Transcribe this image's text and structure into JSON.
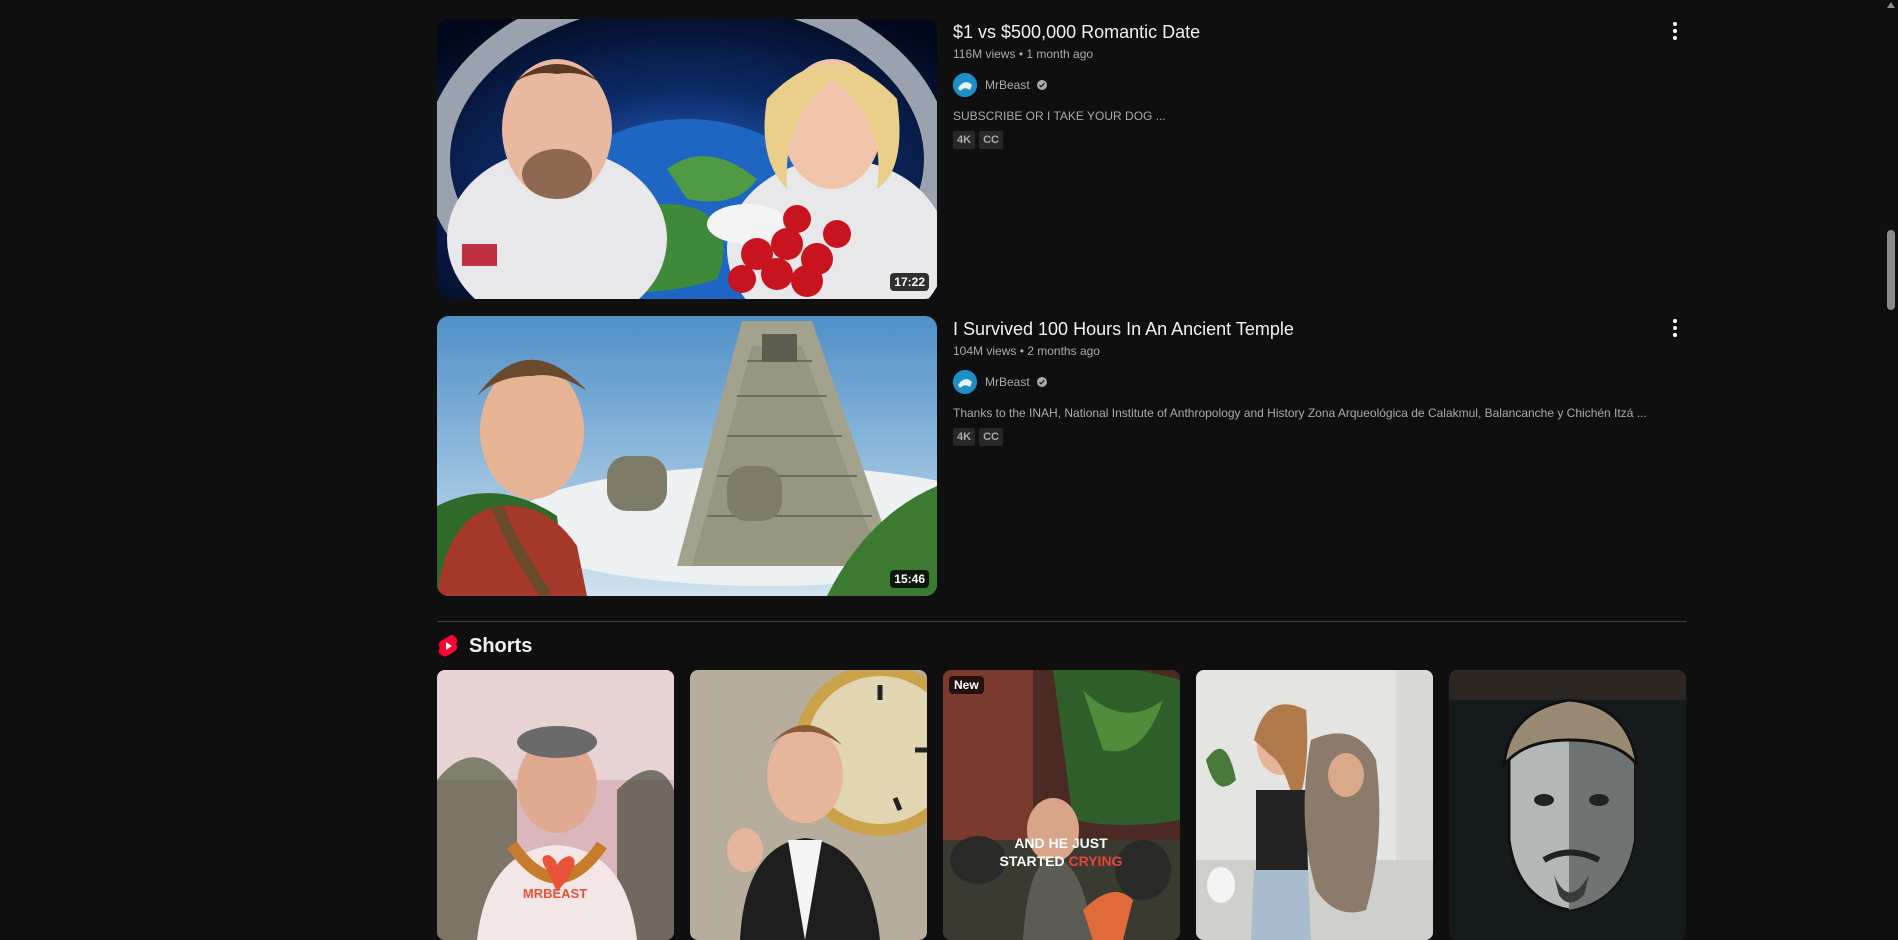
{
  "videos": [
    {
      "title": "$1 vs $500,000 Romantic Date",
      "views": "116M views",
      "age": "1 month ago",
      "channel": "MrBeast",
      "description": "SUBSCRIBE OR I TAKE YOUR DOG ...",
      "badges": [
        "4K",
        "CC"
      ],
      "duration": "17:22"
    },
    {
      "title": "I Survived 100 Hours In An Ancient Temple",
      "views": "104M views",
      "age": "2 months ago",
      "channel": "MrBeast",
      "description": "Thanks to the INAH, National Institute of Anthropology and History Zona Arqueológica de Calakmul, Balancanche y Chichén Itzá ...",
      "badges": [
        "4K",
        "CC"
      ],
      "duration": "15:46"
    }
  ],
  "meta_separator": "•",
  "shorts": {
    "title": "Shorts",
    "items": [
      {
        "overlay": "MRBEAST"
      },
      {
        "overlay": ""
      },
      {
        "badge": "New",
        "caption_line1": "AND HE JUST",
        "caption_line2_a": "STARTED ",
        "caption_line2_b": "CRYING"
      },
      {
        "overlay": ""
      },
      {
        "overlay": ""
      }
    ]
  },
  "colors": {
    "background": "#0f0f0f",
    "shorts_red": "#ff0033",
    "text_primary": "#f1f1f1",
    "text_secondary": "#aaaaaa"
  },
  "icons": {
    "menu": "more-vert-icon",
    "verified": "verified-check-icon",
    "shorts": "shorts-logo-icon"
  }
}
